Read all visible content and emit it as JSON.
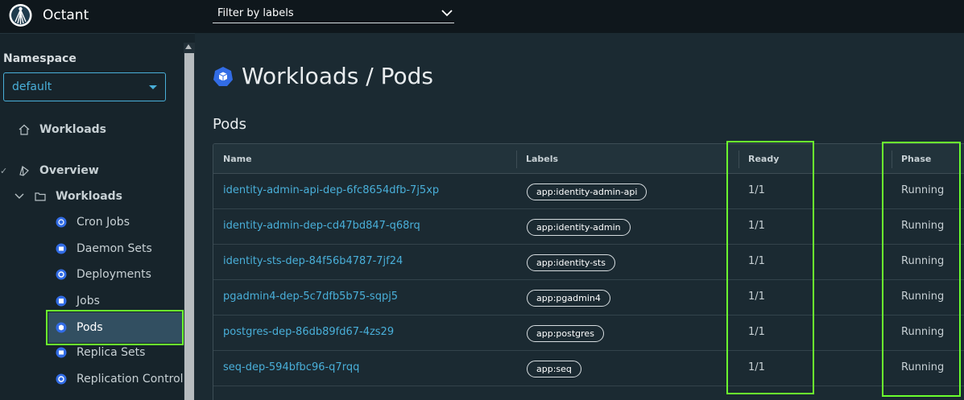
{
  "app": {
    "title": "Octant"
  },
  "filter": {
    "placeholder": "Filter by labels"
  },
  "sidebar": {
    "namespace_label": "Namespace",
    "namespace_value": "default",
    "items": [
      {
        "label": "Workloads"
      },
      {
        "label": "Overview"
      },
      {
        "label": "Workloads"
      }
    ],
    "subitems": [
      {
        "label": "Cron Jobs"
      },
      {
        "label": "Daemon Sets"
      },
      {
        "label": "Deployments"
      },
      {
        "label": "Jobs"
      },
      {
        "label": "Pods"
      },
      {
        "label": "Replica Sets"
      },
      {
        "label": "Replication Controll"
      }
    ]
  },
  "main": {
    "title": "Workloads / Pods",
    "section_title": "Pods",
    "columns": [
      "Name",
      "Labels",
      "Ready",
      "Phase"
    ],
    "rows": [
      {
        "name": "identity-admin-api-dep-6fc8654dfb-7j5xp",
        "label": "app:identity-admin-api",
        "ready": "1/1",
        "phase": "Running"
      },
      {
        "name": "identity-admin-dep-cd47bd847-q68rq",
        "label": "app:identity-admin",
        "ready": "1/1",
        "phase": "Running"
      },
      {
        "name": "identity-sts-dep-84f56b4787-7jf24",
        "label": "app:identity-sts",
        "ready": "1/1",
        "phase": "Running"
      },
      {
        "name": "pgadmin4-dep-5c7dfb5b75-sqpj5",
        "label": "app:pgadmin4",
        "ready": "1/1",
        "phase": "Running"
      },
      {
        "name": "postgres-dep-86db89fd67-4zs29",
        "label": "app:postgres",
        "ready": "1/1",
        "phase": "Running"
      },
      {
        "name": "seq-dep-594bfbc96-q7rqq",
        "label": "app:seq",
        "ready": "1/1",
        "phase": "Running"
      }
    ]
  },
  "colors": {
    "accent": "#49afd9",
    "highlight": "#6bff2e",
    "background": "#1b2a32",
    "sidebar": "#17242b",
    "header": "#0f171c"
  }
}
